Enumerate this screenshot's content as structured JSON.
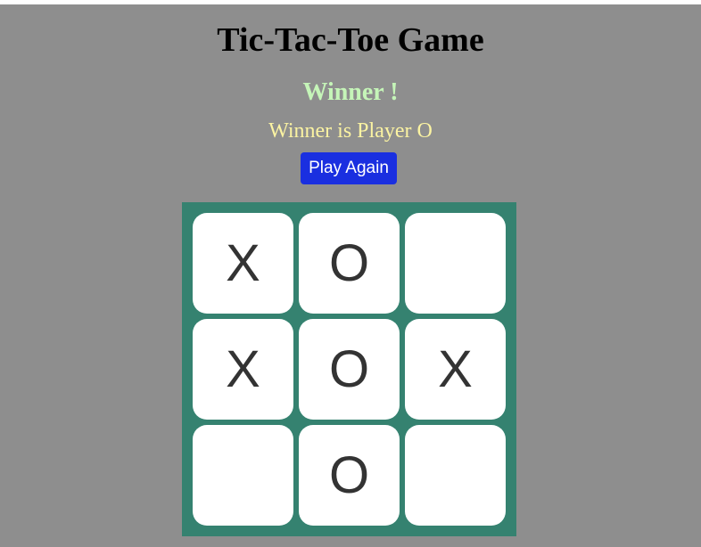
{
  "game": {
    "title": "Tic-Tac-Toe Game",
    "status_heading": "Winner !",
    "status_message": "Winner is Player O",
    "play_again_label": "Play Again"
  },
  "board": {
    "cells": [
      "X",
      "O",
      "",
      "X",
      "O",
      "X",
      "",
      "O",
      ""
    ]
  },
  "colors": {
    "page_background": "#8e8e8e",
    "board_background": "#358270",
    "heading_color": "#c5f5b8",
    "message_color": "#fbf3a2",
    "button_background": "#1a2fe0",
    "mark_color": "#333333"
  }
}
